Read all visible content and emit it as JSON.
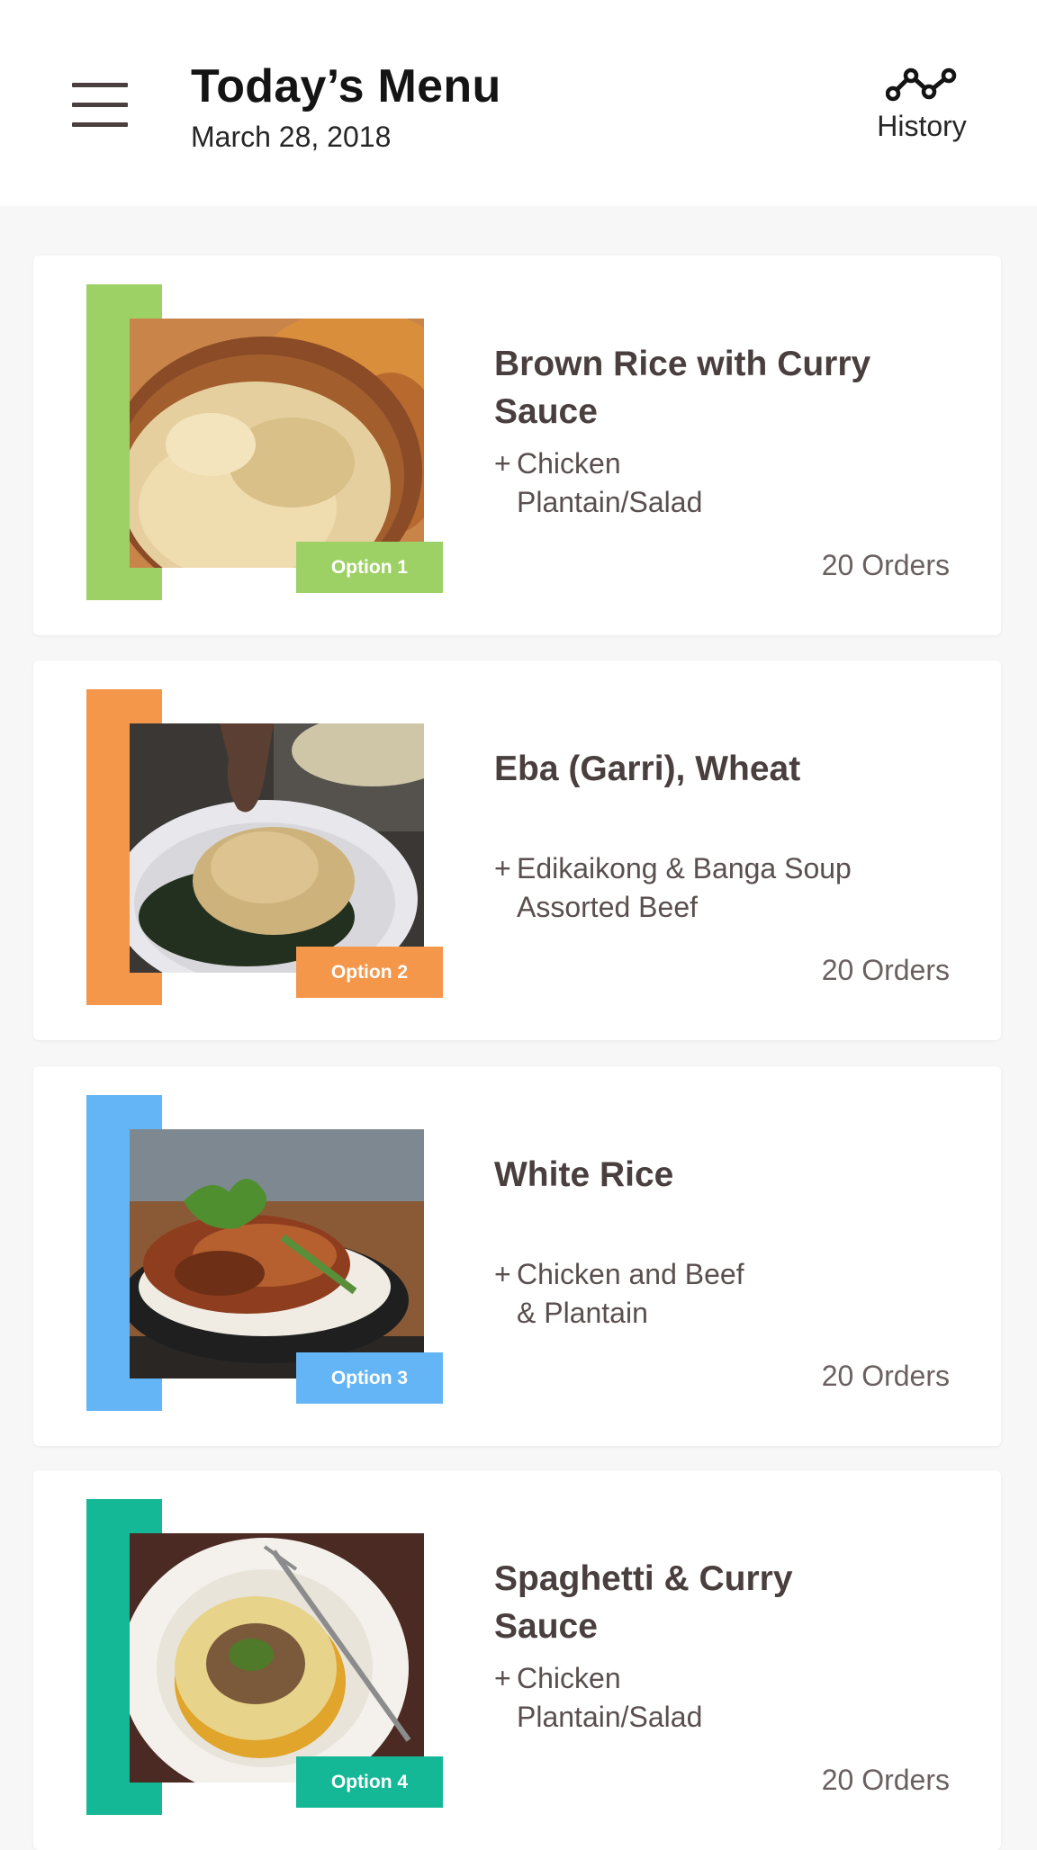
{
  "header": {
    "title": "Today’s Menu",
    "date": "March 28, 2018",
    "history_label": "History"
  },
  "cards": [
    {
      "name": "Brown Rice with Curry Sauce",
      "plus": "+",
      "sides": [
        "Chicken",
        "Plantain/Salad"
      ],
      "option": "Option 1",
      "orders": "20 Orders",
      "color": "#9dd166",
      "image": "brown-rice-bowl"
    },
    {
      "name": "Eba (Garri), Wheat",
      "plus": "+",
      "sides": [
        "Edikaikong & Banga Soup",
        "Assorted Beef"
      ],
      "option": "Option 2",
      "orders": "20 Orders",
      "color": "#f5974b",
      "image": "eba-plate"
    },
    {
      "name": "White Rice",
      "plus": "+",
      "sides": [
        "Chicken and Beef",
        "& Plantain"
      ],
      "option": "Option 3",
      "orders": "20 Orders",
      "color": "#64b5f6",
      "image": "white-rice-stew"
    },
    {
      "name": "Spaghetti & Curry Sauce",
      "plus": "+",
      "sides": [
        "Chicken",
        "Plantain/Salad"
      ],
      "option": "Option 4",
      "orders": "20 Orders",
      "color": "#14b896",
      "image": "spaghetti-plate"
    }
  ]
}
